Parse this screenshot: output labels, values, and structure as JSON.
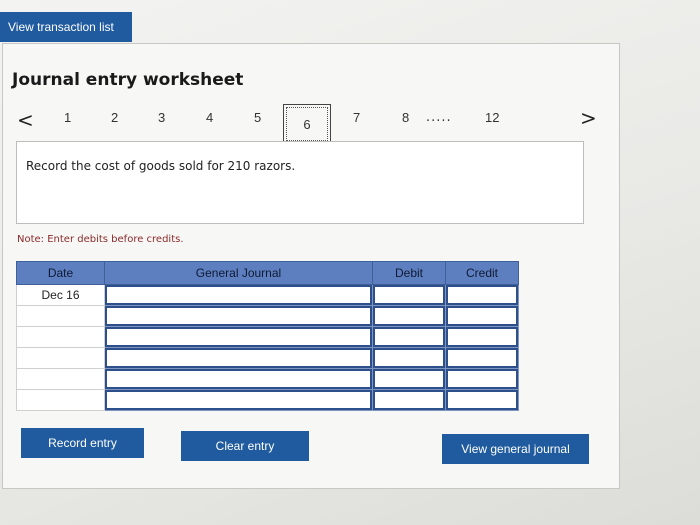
{
  "header": {
    "view_transaction_list": "View transaction list"
  },
  "worksheet": {
    "title": "Journal entry worksheet",
    "nav": {
      "prev": "<",
      "next": ">",
      "steps": [
        "1",
        "2",
        "3",
        "4",
        "5",
        "6",
        "7",
        "8",
        "12"
      ],
      "active_step": "6",
      "ellipsis": "....."
    },
    "question": "Record the cost of goods sold for 210 razors.",
    "note": "Note: Enter debits before credits."
  },
  "table": {
    "headers": {
      "date": "Date",
      "general_journal": "General Journal",
      "debit": "Debit",
      "credit": "Credit"
    },
    "rows": [
      {
        "date": "Dec 16",
        "account": "",
        "debit": "",
        "credit": ""
      },
      {
        "date": "",
        "account": "",
        "debit": "",
        "credit": ""
      },
      {
        "date": "",
        "account": "",
        "debit": "",
        "credit": ""
      },
      {
        "date": "",
        "account": "",
        "debit": "",
        "credit": ""
      },
      {
        "date": "",
        "account": "",
        "debit": "",
        "credit": ""
      },
      {
        "date": "",
        "account": "",
        "debit": "",
        "credit": ""
      }
    ]
  },
  "buttons": {
    "record_entry": "Record entry",
    "clear_entry": "Clear entry",
    "view_general_journal": "View general journal"
  },
  "colors": {
    "button_blue": "#1f5b9e",
    "header_blue": "#5d7fc0",
    "note_red": "#8c2b2b"
  }
}
